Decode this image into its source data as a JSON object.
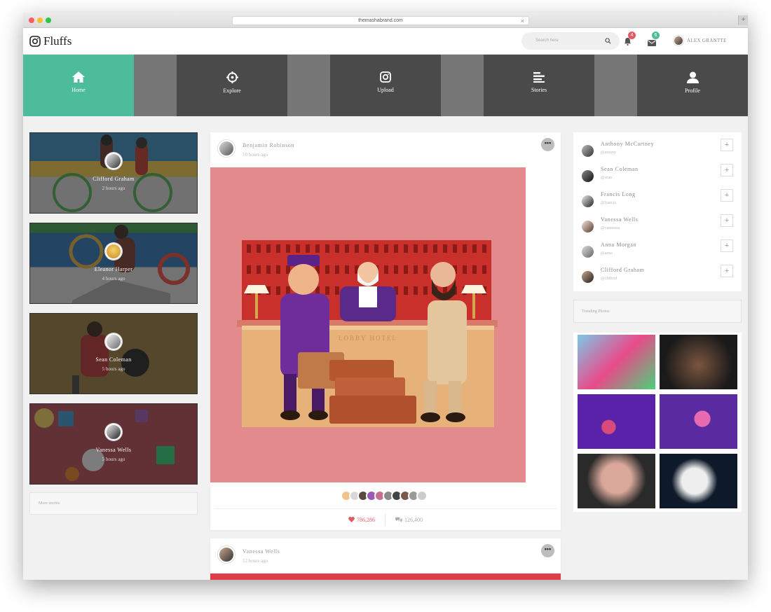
{
  "browser": {
    "url": "themashabrand.com"
  },
  "brand": {
    "name": "Fluffs"
  },
  "search": {
    "placeholder": "Search here"
  },
  "notifications": {
    "bell_count": "4",
    "mail_count": "6"
  },
  "user": {
    "name": "ALEX GRANTTE"
  },
  "nav": [
    {
      "label": "Home",
      "icon": "home-icon",
      "active": true
    },
    {
      "label": "Explore",
      "icon": "crosshair-icon",
      "active": false
    },
    {
      "label": "Upload",
      "icon": "camera-icon",
      "active": false
    },
    {
      "label": "Stories",
      "icon": "stories-icon",
      "active": false
    },
    {
      "label": "Profile",
      "icon": "user-icon",
      "active": false
    }
  ],
  "stories": [
    {
      "name": "Clifford Graham",
      "time": "2 hours ago"
    },
    {
      "name": "Eleanor Harper",
      "time": "4 hours ago"
    },
    {
      "name": "Sean Coleman",
      "time": "5 hours ago"
    },
    {
      "name": "Vanessa Wells",
      "time": "5 hours ago"
    }
  ],
  "stories_more": "More stories",
  "posts": [
    {
      "author": "Benjamin Robinson",
      "time": "10 hours ago",
      "likes": "786,286",
      "comments": "126,400",
      "sign": "LOBBY HOTEL"
    },
    {
      "author": "Vanessa Wells",
      "time": "12 hours ago"
    }
  ],
  "suggestions": [
    {
      "name": "Anthony McCartney",
      "handle": "@antony"
    },
    {
      "name": "Sean Coleman",
      "handle": "@sean"
    },
    {
      "name": "Francis Long",
      "handle": "@francis"
    },
    {
      "name": "Vanessa Wells",
      "handle": "@vannessa"
    },
    {
      "name": "Anna Morgan",
      "handle": "@anna"
    },
    {
      "name": "Clifford Graham",
      "handle": "@clifford"
    }
  ],
  "follow_symbol": "+",
  "trending": {
    "title": "Trending Photos"
  },
  "colors": {
    "accent": "#4cbc9a",
    "nav_dark": "#4a4a4a",
    "like": "#e05a63",
    "badge_red": "#e05a63",
    "badge_green": "#4cbc9a"
  }
}
